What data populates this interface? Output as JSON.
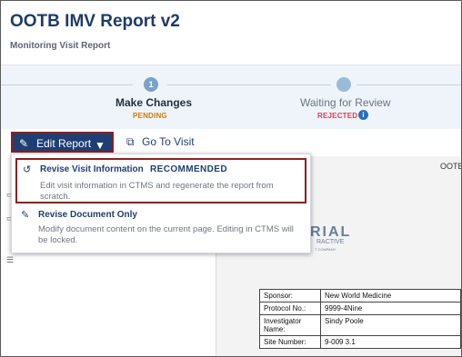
{
  "header": {
    "title": "OOTB IMV Report v2",
    "subtitle": "Monitoring Visit Report"
  },
  "stepper": {
    "steps": [
      {
        "number": "1",
        "label": "Make Changes",
        "status": "PENDING"
      },
      {
        "label": "Waiting for Review",
        "status": "REJECTED",
        "info_icon": "i"
      }
    ]
  },
  "toolbar": {
    "edit_report_label": "Edit Report",
    "go_to_visit_label": "Go To Visit",
    "pencil_icon": "✎",
    "caret_icon": "▼",
    "external_link_icon": "⧉"
  },
  "dropdown": {
    "options": [
      {
        "icon": "↺",
        "title": "Revise Visit Information",
        "badge": "RECOMMENDED",
        "description": "Edit visit information in CTMS and regenerate the report from scratch."
      },
      {
        "icon": "✎",
        "title": "Revise Document Only",
        "description": "Modify document content on the current page. Editing in CTMS will be locked."
      }
    ]
  },
  "document": {
    "header_fragment": "OOTB",
    "logo_fragment": "RIAL",
    "logo_sub1": "RACTIVE",
    "logo_sub2": "T COMPANY",
    "table": [
      {
        "key": "Sponsor:",
        "value": "New World Medicine"
      },
      {
        "key": "Protocol No.:",
        "value": "9999-4Nine"
      },
      {
        "key": "Investigator Name:",
        "value": "Sindy Poole"
      },
      {
        "key": "Site Number:",
        "value": "9-009 3.1"
      }
    ]
  },
  "colors": {
    "primary": "#1f3f73",
    "pending": "#c57d12",
    "rejected": "#d4435c",
    "highlight_border": "#8c1f1f"
  }
}
